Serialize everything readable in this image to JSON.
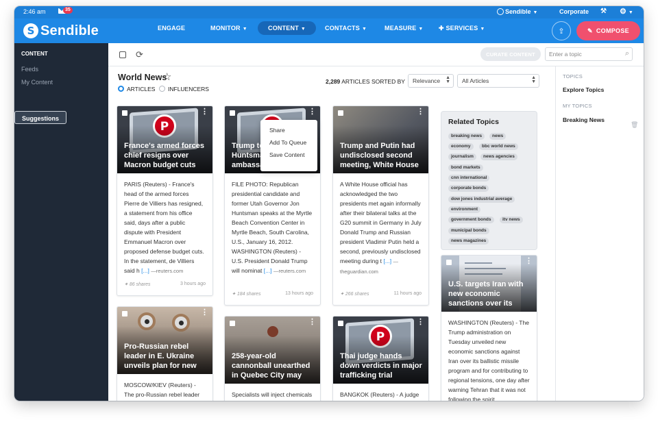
{
  "status_bar": {
    "time": "2:46 am",
    "mail_badge": "35",
    "brand": "Sendible",
    "account": "Corporate"
  },
  "navbar": {
    "logo_text": "Sendible",
    "items": [
      {
        "label": "ENGAGE"
      },
      {
        "label": "MONITOR"
      },
      {
        "label": "CONTENT",
        "active": true
      },
      {
        "label": "CONTACTS"
      },
      {
        "label": "MEASURE"
      },
      {
        "label": "SERVICES"
      }
    ],
    "compose_label": "COMPOSE"
  },
  "sidebar": {
    "heading": "CONTENT",
    "items": [
      {
        "label": "Suggestions",
        "selected": true
      },
      {
        "label": "Feeds"
      },
      {
        "label": "My Content"
      }
    ]
  },
  "toolbar": {
    "curate_label": "CURATE CONTENT",
    "topic_placeholder": "Enter a topic"
  },
  "feed": {
    "title": "World News",
    "radio_articles": "ARTICLES",
    "radio_influencers": "INFLUENCERS",
    "count": "2,289",
    "sorted_label": "ARTICLES SORTED BY",
    "sort_value": "Relevance",
    "filter_value": "All Articles"
  },
  "cards": [
    {
      "headline": "France's armed forces chief resigns over Macron budget cuts",
      "body": "PARIS (Reuters) - France's head of the armed forces Pierre de Villiers has resigned, a statement from his office said, days after a public dispute with President Emmanuel Macron over proposed defense budget cuts. In the statement, de Villiers said h",
      "more": "[...]",
      "source": "—reuters.com",
      "shares": "86 shares",
      "ago": "3 hours ago"
    },
    {
      "headline": "Trump to name Huntsman as ambassador: White",
      "body": "FILE PHOTO: Republican presidential candidate and former Utah Governor Jon Huntsman speaks at the Myrtle Beach Convention Center in Myrtle Beach, South Carolina, U.S., January 16, 2012. WASHINGTON (Reuters) - U.S. President Donald Trump will nominat",
      "more": "[...]",
      "source": "—reuters.com",
      "shares": "184 shares",
      "ago": "13 hours ago"
    },
    {
      "headline": "Trump and Putin had undisclosed second meeting, White House",
      "body": "A White House official has acknowledged the two presidents met again informally after their bilateral talks at the G20 summit in Germany in July Donald Trump and Russian president Vladimir Putin held a second, previously undisclosed meeting during t",
      "more": "[...]",
      "source": "—theguardian.com",
      "shares": "266 shares",
      "ago": "11 hours ago"
    },
    {
      "headline": "U.S. targets Iran with new economic sanctions over its",
      "body": "WASHINGTON (Reuters) - The Trump administration on Tuesday unveiled new economic sanctions against Iran over its ballistic missile program and for contributing to regional tensions, one day after warning Tehran that it was not following the spirit"
    },
    {
      "headline": "Pro-Russian rebel leader in E. Ukraine unveils plan for new",
      "body": "MOSCOW/KIEV (Reuters) - The pro-Russian rebel leader"
    },
    {
      "headline": "258-year-old cannonball unearthed in Quebec City may",
      "body": "Specialists will inject chemicals"
    },
    {
      "headline": "Thai judge hands down verdicts in major trafficking trial",
      "body": "BANGKOK (Reuters) - A judge"
    }
  ],
  "context_menu": {
    "items": [
      "Share",
      "Add To Queue",
      "Save Content"
    ]
  },
  "related": {
    "title": "Related Topics",
    "tags": [
      "breaking news",
      "news",
      "economy",
      "bbc world news",
      "journalism",
      "news agencies",
      "bond markets",
      "cnn international",
      "corporate bonds",
      "dow jones industrial average",
      "environment",
      "government bonds",
      "itv news",
      "municipal bonds",
      "news magazines"
    ]
  },
  "right_panel": {
    "topics_heading": "TOPICS",
    "explore": "Explore Topics",
    "my_topics_heading": "MY TOPICS",
    "my_topic_item": "Breaking News"
  }
}
